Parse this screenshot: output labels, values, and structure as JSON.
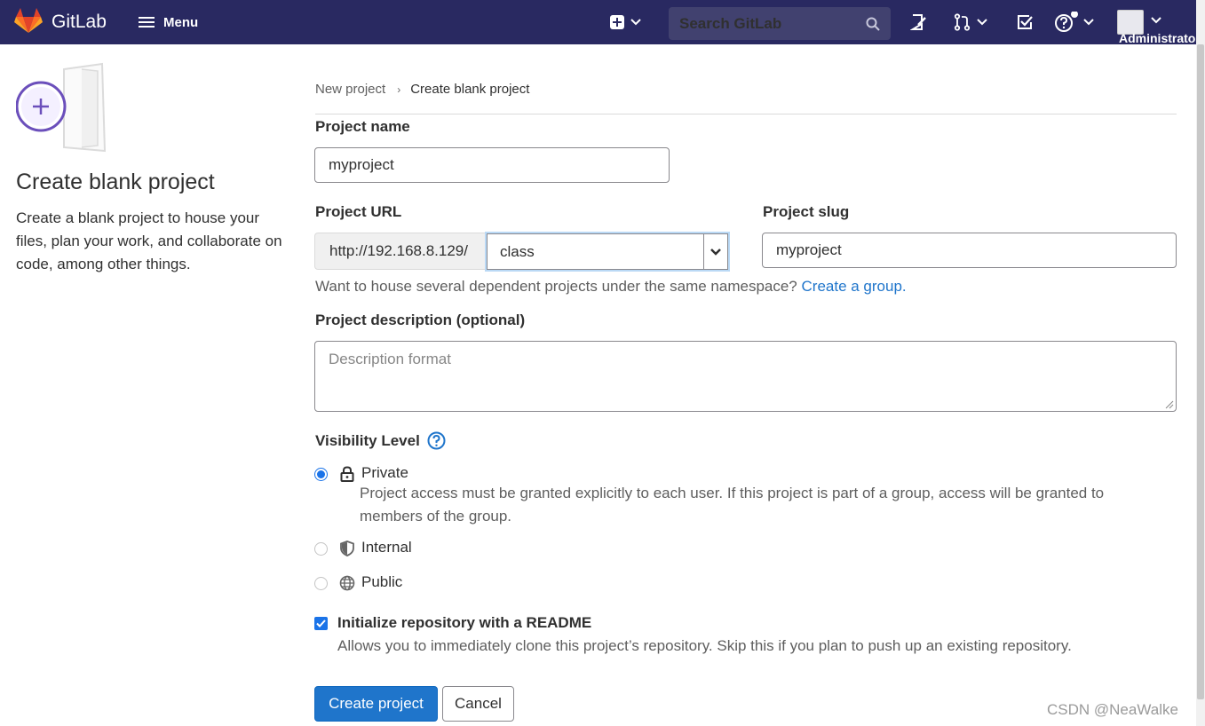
{
  "navbar": {
    "brand": "GitLab",
    "menu_label": "Menu",
    "search_placeholder": "Search GitLab",
    "user_name": "Administrator"
  },
  "sidebar": {
    "title": "Create blank project",
    "description": "Create a blank project to house your files, plan your work, and collaborate on code, among other things."
  },
  "breadcrumb": {
    "parent": "New project",
    "current": "Create blank project"
  },
  "form": {
    "project_name_label": "Project name",
    "project_name_value": "myproject",
    "project_url_label": "Project URL",
    "project_url_prefix": "http://192.168.8.129/",
    "namespace_value": "class",
    "project_slug_label": "Project slug",
    "project_slug_value": "myproject",
    "group_help_text": "Want to house several dependent projects under the same namespace?",
    "group_help_link": "Create a group.",
    "description_label": "Project description (optional)",
    "description_placeholder": "Description format",
    "visibility_label": "Visibility Level",
    "visibility_options": [
      {
        "label": "Private",
        "icon": "lock-icon",
        "checked": true,
        "help": "Project access must be granted explicitly to each user. If this project is part of a group, access will be granted to members of the group."
      },
      {
        "label": "Internal",
        "icon": "shield-icon",
        "checked": false
      },
      {
        "label": "Public",
        "icon": "globe-icon",
        "checked": false
      }
    ],
    "readme_label": "Initialize repository with a README",
    "readme_checked": true,
    "readme_help": "Allows you to immediately clone this project’s repository. Skip this if you plan to push up an existing repository.",
    "create_button": "Create project",
    "cancel_button": "Cancel"
  },
  "watermark": "CSDN @NeaWalke",
  "colors": {
    "navbar": "#292961",
    "primary": "#1f75cb",
    "accent_purple": "#6b4fbb",
    "logo_orange": "#e24329"
  }
}
